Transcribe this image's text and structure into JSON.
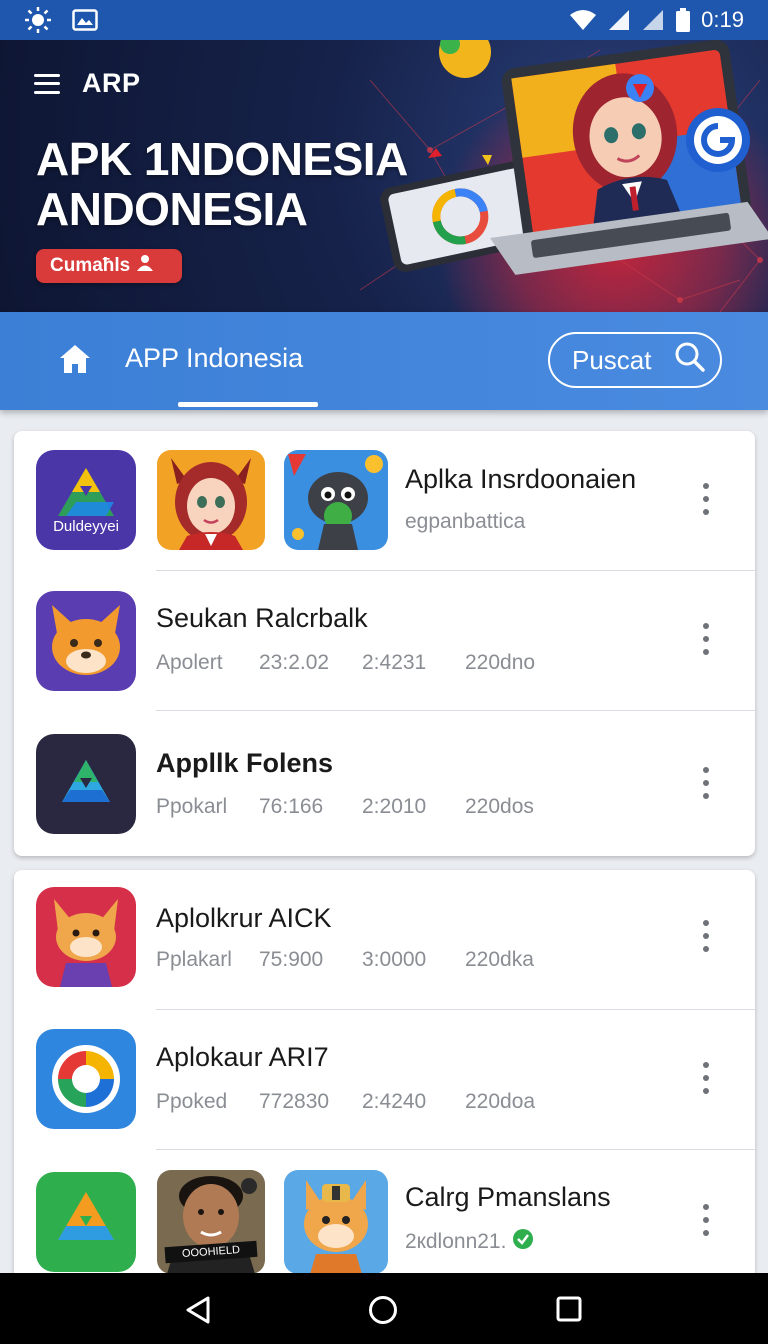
{
  "status_bar": {
    "time": "0:19"
  },
  "header": {
    "app_name": "ARP",
    "hero_title_line1": "APK 1NDONESIA",
    "hero_title_line2": "ANDONESIA",
    "badge_label": "Cumaħls"
  },
  "nav": {
    "title": "APP Indonesia",
    "search_label": "Puscat"
  },
  "apps": [
    {
      "title": "Aplka Insrdoonaien",
      "subtitle": "egpanbattica",
      "icon_label": "Duldeyyei"
    },
    {
      "title": "Seukan Ralcrbalk",
      "meta": [
        "Apolert",
        "23:2.02",
        "2:4231",
        "220dno"
      ]
    },
    {
      "title": "Appllk Folens",
      "meta": [
        "Ppokarl",
        "76:166",
        "2:2010",
        "220dos"
      ]
    },
    {
      "title": "Aplolkrur AICK",
      "meta": [
        "Pplakarl",
        "75:900",
        "3:0000",
        "220dka"
      ]
    },
    {
      "title": "Aplokaur ARI7",
      "meta": [
        "Ppoked",
        "772830",
        "2:4240",
        "220doa"
      ]
    },
    {
      "title": "Calrg Pmanslans",
      "subtitle": "2кdlonn21."
    }
  ],
  "thumb_text": "OOOHIELD",
  "colors": {
    "status_bar": "#1e57ad",
    "nav_bar": "#3b7fd6",
    "badge": "#d93a3a"
  }
}
